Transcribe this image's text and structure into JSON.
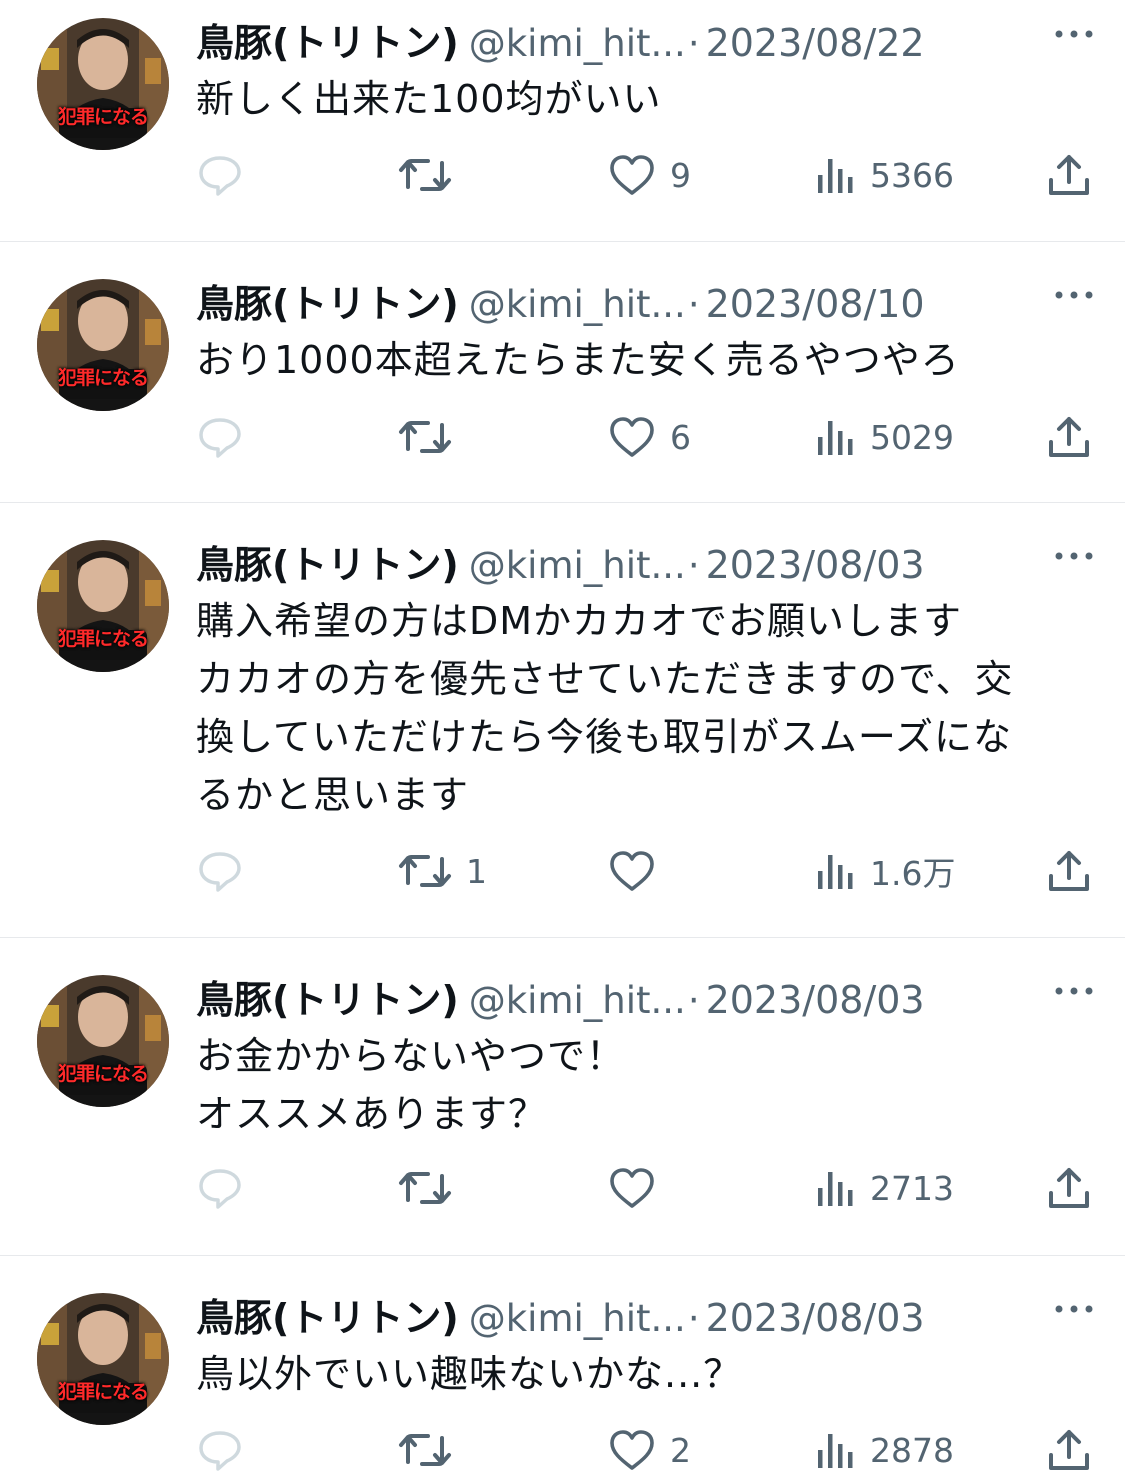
{
  "tweets": [
    {
      "author_name": "鳥豚(トリトン)",
      "handle": "@kimi_hit...",
      "separator": "·",
      "date": "2023/08/22",
      "avatar_caption": "犯罪になる",
      "text_lines": [
        "新しく出来た100均がいい"
      ],
      "replies": "",
      "retweets": "",
      "likes": "9",
      "views": "5366"
    },
    {
      "author_name": "鳥豚(トリトン)",
      "handle": "@kimi_hit...",
      "separator": "·",
      "date": "2023/08/10",
      "avatar_caption": "犯罪になる",
      "text_lines": [
        "おり1000本超えたらまた安く売るやつやろ"
      ],
      "replies": "",
      "retweets": "",
      "likes": "6",
      "views": "5029"
    },
    {
      "author_name": "鳥豚(トリトン)",
      "handle": "@kimi_hit...",
      "separator": "·",
      "date": "2023/08/03",
      "avatar_caption": "犯罪になる",
      "text_lines": [
        "購入希望の方はDMかカカオでお願いします",
        "カカオの方を優先させていただきますので、交",
        "換していただけたら今後も取引がスムーズにな",
        "るかと思います"
      ],
      "replies": "",
      "retweets": "1",
      "likes": "",
      "views": "1.6万"
    },
    {
      "author_name": "鳥豚(トリトン)",
      "handle": "@kimi_hit...",
      "separator": "·",
      "date": "2023/08/03",
      "avatar_caption": "犯罪になる",
      "text_lines": [
        "お金かからないやつで！",
        "オススメあります？"
      ],
      "replies": "",
      "retweets": "",
      "likes": "",
      "views": "2713"
    },
    {
      "author_name": "鳥豚(トリトン)",
      "handle": "@kimi_hit...",
      "separator": "·",
      "date": "2023/08/03",
      "avatar_caption": "犯罪になる",
      "text_lines": [
        "鳥以外でいい趣味ないかな...？"
      ],
      "replies": "",
      "retweets": "",
      "likes": "2",
      "views": "2878"
    }
  ],
  "icons": {
    "reply": "reply-icon",
    "retweet": "retweet-icon",
    "like": "heart-icon",
    "views": "views-chart-icon",
    "share": "share-icon",
    "more": "more-dots-icon"
  },
  "colors": {
    "text": "#0f1419",
    "secondary": "#536471",
    "divider": "#e7e9ec",
    "reply_icon": "#cfd9de"
  }
}
